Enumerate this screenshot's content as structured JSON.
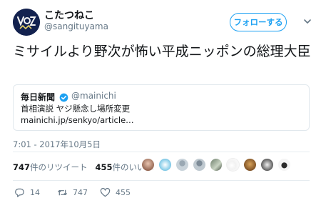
{
  "user": {
    "display_name": "こたつねこ",
    "handle": "@sangituyama"
  },
  "follow_button": {
    "label": "フォローする"
  },
  "tweet": {
    "text": "ミサイルより野次が怖い平成ニッポンの総理大臣"
  },
  "quoted_tweet": {
    "name": "毎日新聞",
    "handle": "@mainichi",
    "text": "首相演説 ヤジ懸念し場所変更",
    "link": "mainichi.jp/senkyo/article…"
  },
  "timestamp": "7:01 - 2017年10月5日",
  "stats": {
    "retweets_count": "747",
    "retweets_label": "件のリツイート",
    "likes_count": "455",
    "likes_label": "件のいいね"
  },
  "actions": {
    "reply_count": "14",
    "retweet_count": "747",
    "like_count": "455"
  },
  "colors": {
    "accent": "#1da1f2",
    "secondary_text": "#657786",
    "primary_text": "#14171a",
    "border": "#e1e8ed"
  },
  "icons": [
    "verified-badge-icon",
    "chevron-down-icon",
    "reply-icon",
    "retweet-icon",
    "like-icon"
  ],
  "liker_avatars_count": 9
}
